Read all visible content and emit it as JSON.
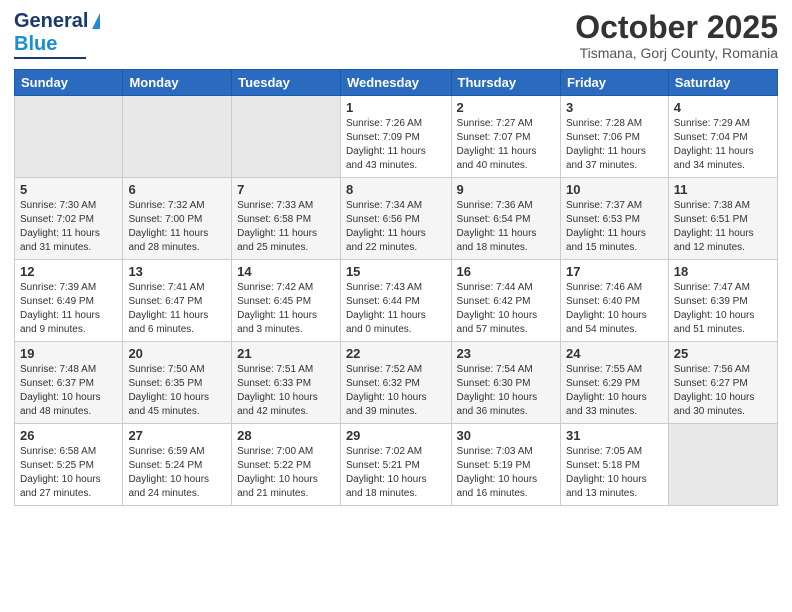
{
  "logo": {
    "line1": "General",
    "line2": "Blue"
  },
  "header": {
    "month": "October 2025",
    "location": "Tismana, Gorj County, Romania"
  },
  "days_of_week": [
    "Sunday",
    "Monday",
    "Tuesday",
    "Wednesday",
    "Thursday",
    "Friday",
    "Saturday"
  ],
  "weeks": [
    [
      {
        "day": "",
        "info": ""
      },
      {
        "day": "",
        "info": ""
      },
      {
        "day": "",
        "info": ""
      },
      {
        "day": "1",
        "info": "Sunrise: 7:26 AM\nSunset: 7:09 PM\nDaylight: 11 hours\nand 43 minutes."
      },
      {
        "day": "2",
        "info": "Sunrise: 7:27 AM\nSunset: 7:07 PM\nDaylight: 11 hours\nand 40 minutes."
      },
      {
        "day": "3",
        "info": "Sunrise: 7:28 AM\nSunset: 7:06 PM\nDaylight: 11 hours\nand 37 minutes."
      },
      {
        "day": "4",
        "info": "Sunrise: 7:29 AM\nSunset: 7:04 PM\nDaylight: 11 hours\nand 34 minutes."
      }
    ],
    [
      {
        "day": "5",
        "info": "Sunrise: 7:30 AM\nSunset: 7:02 PM\nDaylight: 11 hours\nand 31 minutes."
      },
      {
        "day": "6",
        "info": "Sunrise: 7:32 AM\nSunset: 7:00 PM\nDaylight: 11 hours\nand 28 minutes."
      },
      {
        "day": "7",
        "info": "Sunrise: 7:33 AM\nSunset: 6:58 PM\nDaylight: 11 hours\nand 25 minutes."
      },
      {
        "day": "8",
        "info": "Sunrise: 7:34 AM\nSunset: 6:56 PM\nDaylight: 11 hours\nand 22 minutes."
      },
      {
        "day": "9",
        "info": "Sunrise: 7:36 AM\nSunset: 6:54 PM\nDaylight: 11 hours\nand 18 minutes."
      },
      {
        "day": "10",
        "info": "Sunrise: 7:37 AM\nSunset: 6:53 PM\nDaylight: 11 hours\nand 15 minutes."
      },
      {
        "day": "11",
        "info": "Sunrise: 7:38 AM\nSunset: 6:51 PM\nDaylight: 11 hours\nand 12 minutes."
      }
    ],
    [
      {
        "day": "12",
        "info": "Sunrise: 7:39 AM\nSunset: 6:49 PM\nDaylight: 11 hours\nand 9 minutes."
      },
      {
        "day": "13",
        "info": "Sunrise: 7:41 AM\nSunset: 6:47 PM\nDaylight: 11 hours\nand 6 minutes."
      },
      {
        "day": "14",
        "info": "Sunrise: 7:42 AM\nSunset: 6:45 PM\nDaylight: 11 hours\nand 3 minutes."
      },
      {
        "day": "15",
        "info": "Sunrise: 7:43 AM\nSunset: 6:44 PM\nDaylight: 11 hours\nand 0 minutes."
      },
      {
        "day": "16",
        "info": "Sunrise: 7:44 AM\nSunset: 6:42 PM\nDaylight: 10 hours\nand 57 minutes."
      },
      {
        "day": "17",
        "info": "Sunrise: 7:46 AM\nSunset: 6:40 PM\nDaylight: 10 hours\nand 54 minutes."
      },
      {
        "day": "18",
        "info": "Sunrise: 7:47 AM\nSunset: 6:39 PM\nDaylight: 10 hours\nand 51 minutes."
      }
    ],
    [
      {
        "day": "19",
        "info": "Sunrise: 7:48 AM\nSunset: 6:37 PM\nDaylight: 10 hours\nand 48 minutes."
      },
      {
        "day": "20",
        "info": "Sunrise: 7:50 AM\nSunset: 6:35 PM\nDaylight: 10 hours\nand 45 minutes."
      },
      {
        "day": "21",
        "info": "Sunrise: 7:51 AM\nSunset: 6:33 PM\nDaylight: 10 hours\nand 42 minutes."
      },
      {
        "day": "22",
        "info": "Sunrise: 7:52 AM\nSunset: 6:32 PM\nDaylight: 10 hours\nand 39 minutes."
      },
      {
        "day": "23",
        "info": "Sunrise: 7:54 AM\nSunset: 6:30 PM\nDaylight: 10 hours\nand 36 minutes."
      },
      {
        "day": "24",
        "info": "Sunrise: 7:55 AM\nSunset: 6:29 PM\nDaylight: 10 hours\nand 33 minutes."
      },
      {
        "day": "25",
        "info": "Sunrise: 7:56 AM\nSunset: 6:27 PM\nDaylight: 10 hours\nand 30 minutes."
      }
    ],
    [
      {
        "day": "26",
        "info": "Sunrise: 6:58 AM\nSunset: 5:25 PM\nDaylight: 10 hours\nand 27 minutes."
      },
      {
        "day": "27",
        "info": "Sunrise: 6:59 AM\nSunset: 5:24 PM\nDaylight: 10 hours\nand 24 minutes."
      },
      {
        "day": "28",
        "info": "Sunrise: 7:00 AM\nSunset: 5:22 PM\nDaylight: 10 hours\nand 21 minutes."
      },
      {
        "day": "29",
        "info": "Sunrise: 7:02 AM\nSunset: 5:21 PM\nDaylight: 10 hours\nand 18 minutes."
      },
      {
        "day": "30",
        "info": "Sunrise: 7:03 AM\nSunset: 5:19 PM\nDaylight: 10 hours\nand 16 minutes."
      },
      {
        "day": "31",
        "info": "Sunrise: 7:05 AM\nSunset: 5:18 PM\nDaylight: 10 hours\nand 13 minutes."
      },
      {
        "day": "",
        "info": ""
      }
    ]
  ]
}
